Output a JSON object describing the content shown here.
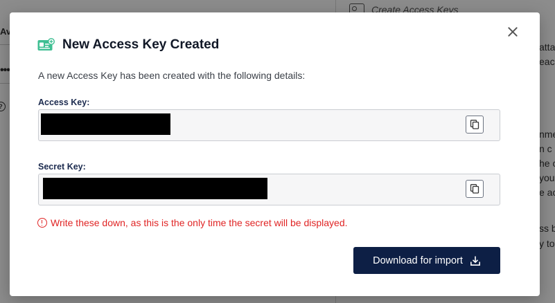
{
  "background": {
    "left_tab_fragment": "Av",
    "left_dots": "•••",
    "help_glyph": "?",
    "right_header": "Create Access Keys",
    "right_fragments": [
      "atta",
      "each",
      "nme",
      "n c",
      "he c",
      "you",
      "e ac",
      "ss b",
      "y to"
    ]
  },
  "modal": {
    "title": "New Access Key Created",
    "title_icon": "access-key-card-icon",
    "intro": "A new Access Key has been created with the following details:",
    "access_key": {
      "label": "Access Key:",
      "value": "",
      "redacted": true
    },
    "secret_key": {
      "label": "Secret Key:",
      "value": "",
      "redacted": true
    },
    "warning": "Write these down, as this is the only time the secret will be displayed.",
    "download_button": "Download for import",
    "colors": {
      "accent": "#0d1f45",
      "icon_green": "#3fbf93",
      "warning_red": "#e02424",
      "label_navy": "#1b2a4e"
    }
  }
}
